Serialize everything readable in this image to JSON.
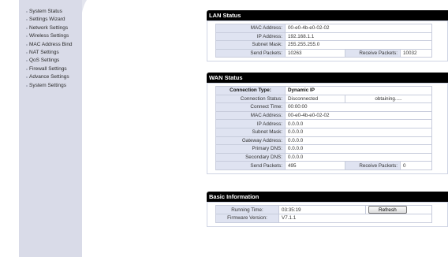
{
  "sidebar": {
    "items": [
      {
        "label": "System Status"
      },
      {
        "label": "Settings Wizard"
      },
      {
        "label": "Network Settings"
      },
      {
        "label": "Wireless Settings"
      },
      {
        "label": "MAC Address Bind"
      },
      {
        "label": "NAT Settings"
      },
      {
        "label": "QoS Settings"
      },
      {
        "label": "Firewall Settings"
      },
      {
        "label": "Advance Settings"
      },
      {
        "label": "System Settings"
      }
    ]
  },
  "lan": {
    "title": "LAN Status",
    "mac_label": "MAC Address:",
    "mac": "00-e0-4b-e0-02-02",
    "ip_label": "IP Address:",
    "ip": "192.168.1.1",
    "mask_label": "Subnet Mask:",
    "mask": "255.255.255.0",
    "send_label": "Send Packets:",
    "send": "10263",
    "recv_label": "Receive Packets:",
    "recv": "10032"
  },
  "wan": {
    "title": "WAN Status",
    "type_label": "Connection Type:",
    "type": "Dynamic IP",
    "status_label": "Connection Status:",
    "status": "Disconnected",
    "status_extra": "obtaining.....",
    "time_label": "Connect Time:",
    "time": "00:00:00",
    "mac_label": "MAC Address:",
    "mac": "00-e0-4b-e0-02-02",
    "ip_label": "IP Address:",
    "ip": "0.0.0.0",
    "mask_label": "Subnet Mask:",
    "mask": "0.0.0.0",
    "gw_label": "Gateway Address:",
    "gw": "0.0.0.0",
    "dns1_label": "Primary DNS:",
    "dns1": "0.0.0.0",
    "dns2_label": "Secondary DNS:",
    "dns2": "0.0.0.0",
    "send_label": "Send Packets:",
    "send": "495",
    "recv_label": "Receive Packets:",
    "recv": "0"
  },
  "basic": {
    "title": "Basic Information",
    "runtime_label": "Running Time:",
    "runtime": "03:35:19",
    "refresh_label": "Refresh",
    "fw_label": "Firmware Version:",
    "fw": "V7.1.1"
  }
}
